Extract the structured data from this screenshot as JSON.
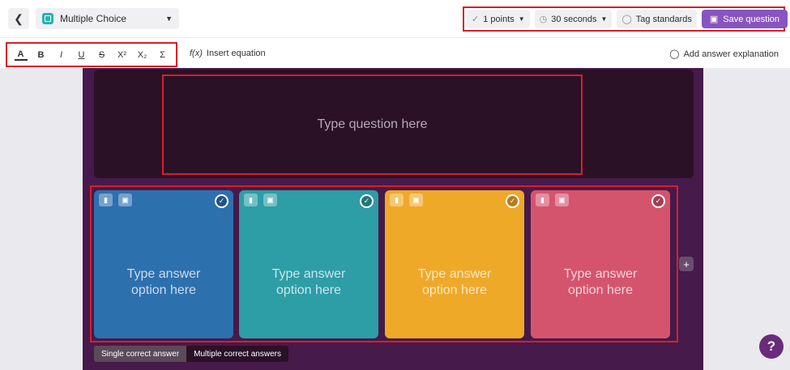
{
  "header": {
    "back_icon": "chevron-left-icon",
    "question_type": "Multiple Choice",
    "points": "1 points",
    "time": "30 seconds",
    "tag_standards": "Tag standards",
    "save_question": "Save question"
  },
  "toolbar": {
    "format_buttons": [
      "A",
      "B",
      "I",
      "U",
      "S",
      "X²",
      "X₂",
      "Σ"
    ],
    "insert_equation": "Insert equation",
    "add_answer_explanation": "Add answer explanation"
  },
  "question": {
    "placeholder": "Type question here"
  },
  "answers": [
    {
      "placeholder_line1": "Type answer",
      "placeholder_line2": "option here",
      "color": "#2d70ae"
    },
    {
      "placeholder_line1": "Type answer",
      "placeholder_line2": "option here",
      "color": "#2d9da6"
    },
    {
      "placeholder_line1": "Type answer",
      "placeholder_line2": "option here",
      "color": "#efa929"
    },
    {
      "placeholder_line1": "Type answer",
      "placeholder_line2": "option here",
      "color": "#d5546d"
    }
  ],
  "answer_mode": {
    "single": "Single correct answer",
    "multiple": "Multiple correct answers"
  },
  "help": "?",
  "colors": {
    "accent": "#8854c0",
    "highlight_outline": "#d6202a",
    "canvas": "#461a4a"
  }
}
